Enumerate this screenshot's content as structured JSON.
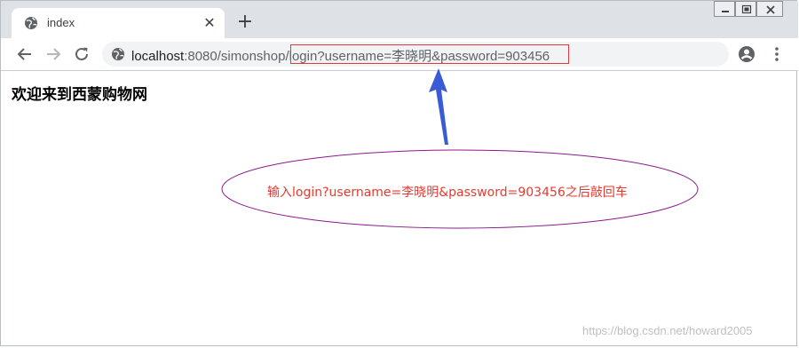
{
  "tab": {
    "title": "index",
    "close_label": "✕",
    "new_tab_label": "+",
    "favicon": "globe-icon"
  },
  "toolbar": {
    "back_icon": "back-arrow-icon",
    "forward_icon": "forward-arrow-icon",
    "reload_icon": "reload-icon",
    "url_host": "localhost",
    "url_rest": ":8080/simonshop/",
    "url_query": "login?username=李晓明&password=903456",
    "profile_icon": "account-circle-icon",
    "menu_icon": "kebab-menu-icon"
  },
  "page": {
    "heading": "欢迎来到西蒙购物网"
  },
  "annotation": {
    "callout_text": "输入login?username=李晓明&password=903456之后敲回车",
    "arrow_color": "#3a5bd6",
    "ellipse_color": "#8b1a8b",
    "text_color": "#e8392f",
    "box_color": "#e0393e"
  },
  "watermark": "https://blog.csdn.net/howard2005"
}
